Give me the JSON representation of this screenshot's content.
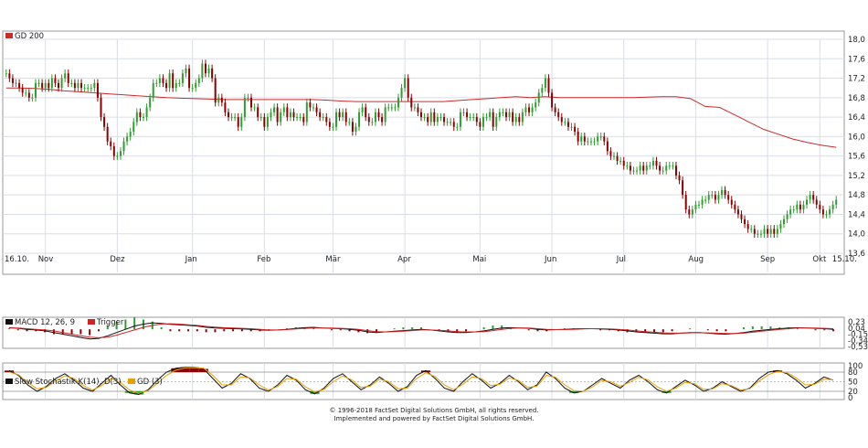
{
  "colors": {
    "up": "#2e9e2e",
    "down": "#8b0000",
    "trend": "#2b35c8",
    "ma": "#cc2a2a",
    "macd": "#111111",
    "trigger": "#d22222",
    "stoch": "#111111",
    "gd3": "#e8a000",
    "grid": "#d9dde8",
    "panel_border": "#999999"
  },
  "copyright": {
    "line1": "© 1996-2018 FactSet Digital Solutions GmbH, all rights reserved.",
    "line2": "Implemented and powered by FactSet Digital Solutions GmbH."
  },
  "chart_data": [
    {
      "type": "candlestick",
      "legend": [
        "GD 200"
      ],
      "y_ticks": [
        "18,0",
        "17,6",
        "17,2",
        "16,8",
        "16,4",
        "16,0",
        "15,6",
        "15,2",
        "14,8",
        "14,4",
        "14,0",
        "13,6"
      ],
      "ylim": [
        13.6,
        18.0
      ],
      "x_labels": [
        "16.10.",
        "Nov",
        "Dez",
        "Jan",
        "Feb",
        "Mär",
        "Apr",
        "Mai",
        "Jun",
        "Jul",
        "Aug",
        "Sep",
        "Okt",
        "15.10."
      ],
      "x_label_index": [
        0,
        12,
        34,
        57,
        79,
        100,
        122,
        145,
        167,
        189,
        211,
        233,
        249,
        255
      ],
      "closes": [
        17.3,
        17.2,
        17.1,
        17.1,
        17.0,
        16.9,
        16.9,
        16.8,
        16.8,
        17.1,
        17.1,
        17.0,
        17.1,
        17.0,
        17.2,
        17.1,
        17.0,
        17.2,
        17.3,
        17.1,
        17.1,
        17.0,
        17.1,
        17.0,
        17.0,
        17.0,
        17.0,
        17.1,
        16.8,
        16.4,
        16.2,
        15.9,
        15.8,
        15.6,
        15.6,
        15.7,
        15.9,
        16.0,
        16.1,
        16.3,
        16.5,
        16.4,
        16.4,
        16.6,
        16.8,
        17.1,
        17.1,
        17.2,
        17.1,
        17.0,
        17.3,
        17.0,
        17.1,
        17.1,
        17.3,
        17.4,
        17.0,
        17.0,
        17.1,
        17.2,
        17.5,
        17.3,
        17.4,
        17.2,
        16.7,
        16.8,
        16.7,
        16.5,
        16.4,
        16.4,
        16.4,
        16.2,
        16.4,
        16.8,
        16.8,
        16.6,
        16.6,
        16.4,
        16.4,
        16.2,
        16.4,
        16.5,
        16.6,
        16.3,
        16.5,
        16.6,
        16.4,
        16.5,
        16.4,
        16.4,
        16.4,
        16.3,
        16.7,
        16.6,
        16.6,
        16.5,
        16.4,
        16.4,
        16.3,
        16.2,
        16.2,
        16.5,
        16.4,
        16.5,
        16.3,
        16.3,
        16.1,
        16.2,
        16.5,
        16.6,
        16.4,
        16.3,
        16.3,
        16.5,
        16.4,
        16.3,
        16.6,
        16.6,
        16.6,
        16.6,
        16.8,
        17.0,
        17.2,
        16.8,
        16.6,
        16.6,
        16.5,
        16.4,
        16.4,
        16.3,
        16.5,
        16.3,
        16.4,
        16.4,
        16.3,
        16.3,
        16.3,
        16.2,
        16.2,
        16.5,
        16.5,
        16.4,
        16.4,
        16.4,
        16.3,
        16.2,
        16.4,
        16.4,
        16.5,
        16.2,
        16.4,
        16.5,
        16.5,
        16.4,
        16.5,
        16.3,
        16.4,
        16.3,
        16.5,
        16.6,
        16.5,
        16.6,
        16.7,
        16.9,
        17.0,
        17.2,
        16.9,
        16.6,
        16.5,
        16.4,
        16.3,
        16.3,
        16.2,
        16.2,
        16.1,
        15.9,
        16.0,
        15.9,
        15.9,
        15.9,
        15.9,
        16.0,
        16.0,
        15.9,
        15.7,
        15.6,
        15.6,
        15.5,
        15.5,
        15.4,
        15.4,
        15.3,
        15.3,
        15.3,
        15.4,
        15.3,
        15.4,
        15.4,
        15.5,
        15.4,
        15.3,
        15.3,
        15.4,
        15.4,
        15.4,
        15.2,
        15.1,
        14.8,
        14.5,
        14.4,
        14.5,
        14.6,
        14.6,
        14.7,
        14.7,
        14.8,
        14.8,
        14.7,
        14.8,
        14.9,
        14.8,
        14.7,
        14.6,
        14.5,
        14.4,
        14.3,
        14.2,
        14.1,
        14.1,
        14.0,
        14.0,
        14.0,
        14.1,
        14.0,
        14.1,
        14.0,
        14.1,
        14.2,
        14.3,
        14.4,
        14.5,
        14.5,
        14.6,
        14.5,
        14.6,
        14.7,
        14.8,
        14.7,
        14.6,
        14.5,
        14.4,
        14.4,
        14.5,
        14.6,
        14.7
      ],
      "gd200": [
        17.0,
        17.0,
        16.99,
        16.97,
        16.94,
        16.92,
        16.9,
        16.88,
        16.86,
        16.84,
        16.82,
        16.8,
        16.79,
        16.78,
        16.77,
        16.76,
        16.76,
        16.76,
        16.76,
        16.76,
        16.76,
        16.76,
        16.75,
        16.73,
        16.72,
        16.72,
        16.72,
        16.72,
        16.72,
        16.72,
        16.72,
        16.74,
        16.76,
        16.78,
        16.8,
        16.82,
        16.8,
        16.82,
        16.8,
        16.8,
        16.8,
        16.8,
        16.8,
        16.8,
        16.81,
        16.82,
        16.82,
        16.78,
        16.62,
        16.6,
        16.45,
        16.3,
        16.15,
        16.05,
        15.95,
        15.88,
        15.82,
        15.78
      ],
      "gd200_x_index": [
        0,
        4,
        8,
        12,
        16,
        20,
        24,
        28,
        32,
        36,
        40,
        44,
        48,
        52,
        56,
        60,
        64,
        68,
        72,
        76,
        80,
        84,
        88,
        92,
        96,
        100,
        104,
        108,
        112,
        116,
        120,
        124,
        128,
        132,
        136,
        140,
        144,
        148,
        152,
        156,
        160,
        164,
        168,
        172,
        176,
        180,
        184,
        188,
        192,
        196,
        200,
        204,
        208,
        212,
        216,
        220,
        224,
        228
      ]
    },
    {
      "type": "line",
      "legend": [
        "MACD 12, 26, 9",
        "Trigger"
      ],
      "y_ticks": [
        "0,23",
        "0,04",
        "-0,15",
        "-0,34",
        "-0,53"
      ],
      "ylim": [
        -0.53,
        0.23
      ],
      "series": [
        {
          "name": "MACD 12, 26, 9",
          "values": [
            0.05,
            0.03,
            0.0,
            -0.02,
            -0.05,
            -0.1,
            -0.15,
            -0.2,
            -0.25,
            -0.3,
            -0.28,
            -0.2,
            -0.1,
            0.0,
            0.1,
            0.16,
            0.2,
            0.18,
            0.15,
            0.14,
            0.12,
            0.1,
            0.06,
            0.04,
            0.03,
            0.02,
            0.01,
            0.0,
            -0.02,
            -0.03,
            -0.02,
            0.0,
            0.03,
            0.05,
            0.06,
            0.04,
            0.03,
            0.02,
            0.0,
            -0.03,
            -0.08,
            -0.1,
            -0.08,
            -0.06,
            -0.04,
            -0.02,
            0.0,
            -0.02,
            -0.05,
            -0.08,
            -0.1,
            -0.1,
            -0.08,
            -0.05,
            0.0,
            0.04,
            0.05,
            0.04,
            0.03,
            0.0,
            -0.02,
            -0.01,
            0.0,
            0.01,
            0.02,
            0.02,
            0.01,
            0.0,
            -0.02,
            -0.05,
            -0.08,
            -0.1,
            -0.12,
            -0.14,
            -0.14,
            -0.12,
            -0.1,
            -0.1,
            -0.12,
            -0.14,
            -0.15,
            -0.13,
            -0.1,
            -0.06,
            -0.03,
            0.0,
            0.02,
            0.04,
            0.05,
            0.04,
            0.03,
            0.02,
            0.0
          ]
        },
        {
          "name": "Trigger",
          "values": [
            0.04,
            0.04,
            0.02,
            0.0,
            -0.02,
            -0.05,
            -0.1,
            -0.15,
            -0.2,
            -0.24,
            -0.26,
            -0.24,
            -0.18,
            -0.1,
            -0.02,
            0.06,
            0.12,
            0.16,
            0.17,
            0.16,
            0.14,
            0.12,
            0.09,
            0.07,
            0.05,
            0.04,
            0.03,
            0.02,
            0.0,
            -0.02,
            -0.02,
            -0.01,
            0.01,
            0.03,
            0.04,
            0.04,
            0.04,
            0.03,
            0.02,
            0.0,
            -0.04,
            -0.07,
            -0.08,
            -0.07,
            -0.06,
            -0.04,
            -0.02,
            -0.02,
            -0.03,
            -0.05,
            -0.07,
            -0.08,
            -0.08,
            -0.07,
            -0.04,
            0.0,
            0.03,
            0.04,
            0.04,
            0.02,
            0.0,
            -0.01,
            -0.01,
            0.0,
            0.01,
            0.02,
            0.02,
            0.01,
            0.0,
            -0.02,
            -0.05,
            -0.07,
            -0.09,
            -0.11,
            -0.12,
            -0.12,
            -0.11,
            -0.1,
            -0.11,
            -0.12,
            -0.13,
            -0.13,
            -0.12,
            -0.09,
            -0.06,
            -0.03,
            0.0,
            0.02,
            0.04,
            0.04,
            0.04,
            0.03,
            0.02
          ]
        }
      ]
    },
    {
      "type": "line",
      "legend": [
        "Slow Stochastik K(14), D(3)",
        "GD (3)"
      ],
      "y_ticks": [
        "100",
        "80",
        "50",
        "20",
        "0"
      ],
      "ylim": [
        0,
        100
      ],
      "series": [
        {
          "name": "Slow Stochastik K(14), D(3)",
          "values": [
            85,
            70,
            40,
            20,
            35,
            60,
            75,
            55,
            30,
            20,
            45,
            70,
            40,
            15,
            10,
            25,
            55,
            80,
            92,
            95,
            95,
            90,
            60,
            30,
            45,
            75,
            60,
            30,
            20,
            40,
            70,
            55,
            25,
            12,
            30,
            60,
            75,
            50,
            25,
            40,
            65,
            45,
            20,
            35,
            70,
            85,
            60,
            30,
            20,
            50,
            75,
            55,
            30,
            45,
            70,
            50,
            25,
            40,
            80,
            60,
            30,
            15,
            20,
            40,
            60,
            45,
            30,
            55,
            70,
            50,
            25,
            15,
            35,
            55,
            40,
            20,
            30,
            50,
            35,
            20,
            30,
            60,
            80,
            85,
            75,
            55,
            30,
            45,
            65,
            55
          ]
        },
        {
          "name": "GD (3)",
          "values": [
            80,
            72,
            48,
            28,
            32,
            52,
            68,
            60,
            38,
            24,
            38,
            60,
            48,
            24,
            14,
            22,
            45,
            70,
            86,
            93,
            94,
            92,
            70,
            40,
            40,
            65,
            62,
            40,
            24,
            35,
            60,
            58,
            34,
            18,
            26,
            50,
            68,
            56,
            32,
            36,
            58,
            50,
            28,
            30,
            60,
            78,
            66,
            40,
            25,
            42,
            65,
            60,
            38,
            42,
            62,
            54,
            32,
            36,
            70,
            64,
            40,
            22,
            20,
            34,
            54,
            50,
            36,
            48,
            64,
            56,
            34,
            20,
            30,
            48,
            44,
            26,
            28,
            44,
            38,
            24,
            28,
            52,
            72,
            82,
            78,
            62,
            40,
            42,
            58,
            56
          ]
        }
      ]
    }
  ]
}
